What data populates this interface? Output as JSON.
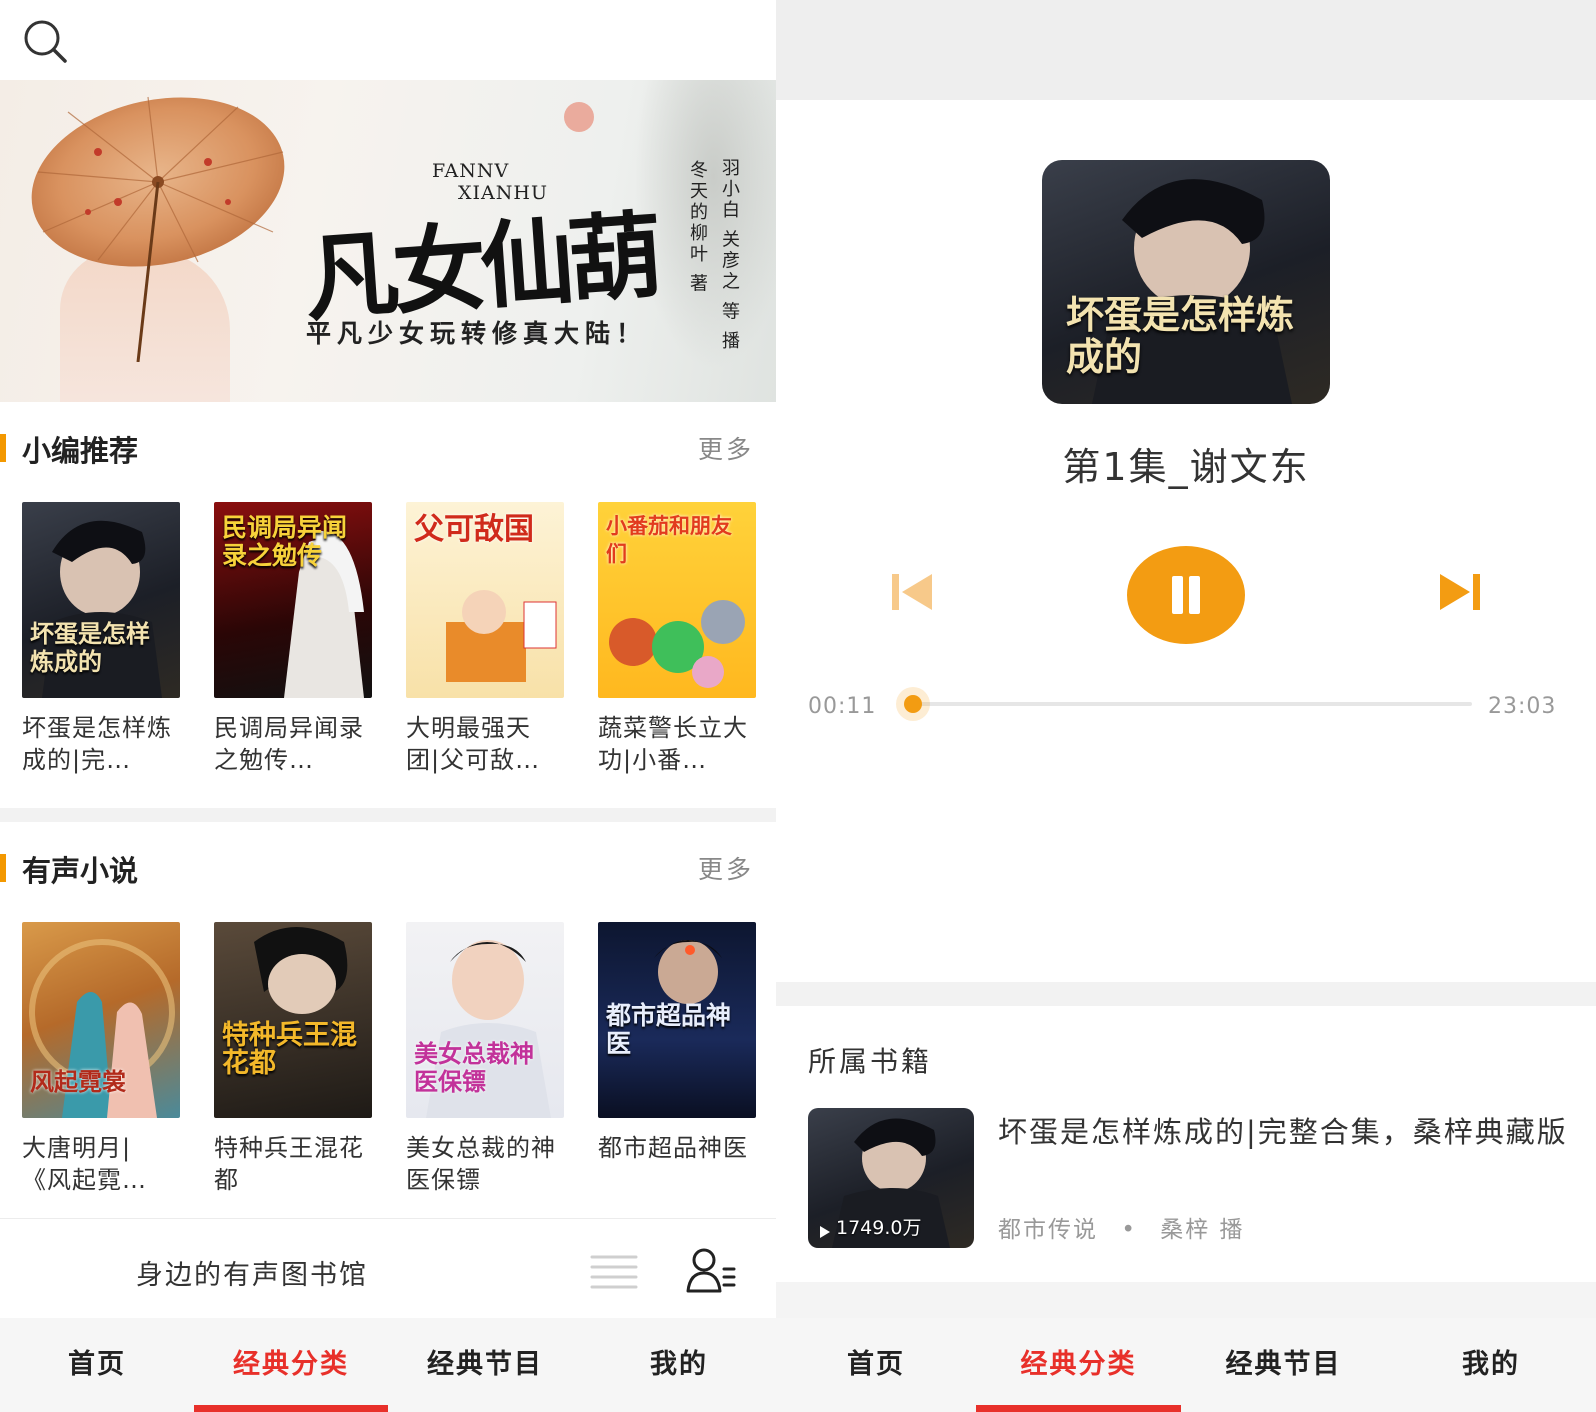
{
  "left": {
    "banner": {
      "title": "凡女仙葫",
      "english_line1": "FANNV",
      "english_line2": "XIANHU",
      "subtitle": "平凡少女玩转修真大陆！",
      "author": "冬天的柳叶 著",
      "narrator": "羽小白 关彦之 等 播"
    },
    "recommend": {
      "title": "小编推荐",
      "more": "更多",
      "books": [
        {
          "title": "坏蛋是怎样炼成的|完…",
          "cover_text": "坏蛋是怎样炼成的"
        },
        {
          "title": "民调局异闻录之勉传…",
          "cover_text": "民调局异闻录之勉传"
        },
        {
          "title": "大明最强天团|父可敌…",
          "cover_text": "父可敌国"
        },
        {
          "title": "蔬菜警长立大功|小番…",
          "cover_text": "小番茄和朋友们"
        }
      ]
    },
    "audio": {
      "title": "有声小说",
      "more": "更多",
      "books": [
        {
          "title": "大唐明月|《风起霓…",
          "cover_text": "风起霓裳"
        },
        {
          "title": "特种兵王混花都",
          "cover_text": "特种兵王混花都"
        },
        {
          "title": "美女总裁的神医保镖",
          "cover_text": "美女总裁神医保镖"
        },
        {
          "title": "都市超品神医",
          "cover_text": "都市超品神医"
        }
      ]
    },
    "library_text": "身边的有声图书馆",
    "tabs": [
      {
        "label": "首页"
      },
      {
        "label": "经典分类"
      },
      {
        "label": "经典节目"
      },
      {
        "label": "我的"
      }
    ]
  },
  "right": {
    "episode_title": "第1集_谢文东",
    "current_time": "00:11",
    "total_time": "23:03",
    "progress_fraction": 0.008,
    "cover_text": "坏蛋是怎样炼成的",
    "section_title": "所属书籍",
    "book": {
      "title": "坏蛋是怎样炼成的|完整合集，桑梓典藏版",
      "category": "都市传说",
      "narrator": "桑梓 播",
      "play_count": "1749.0万"
    },
    "tabs": [
      {
        "label": "首页"
      },
      {
        "label": "经典分类"
      },
      {
        "label": "经典节目"
      },
      {
        "label": "我的"
      }
    ]
  },
  "colors": {
    "accent_orange": "#f39c12",
    "active_red": "#e8302a"
  }
}
